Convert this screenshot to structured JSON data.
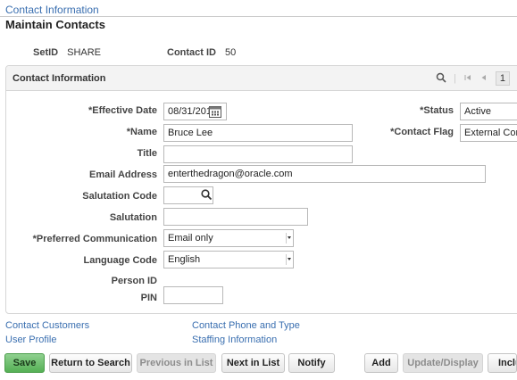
{
  "breadcrumb": "Contact Information",
  "page_title": "Maintain Contacts",
  "keys": {
    "setid_label": "SetID",
    "setid_value": "SHARE",
    "contact_id_label": "Contact ID",
    "contact_id_value": "50"
  },
  "panel": {
    "title": "Contact Information",
    "page_number": "1"
  },
  "form": {
    "effective_date_label": "*Effective Date",
    "effective_date_value": "08/31/2018",
    "status_label": "*Status",
    "status_value": "Active",
    "name_label": "*Name",
    "name_value": "Bruce Lee",
    "contact_flag_label": "*Contact Flag",
    "contact_flag_value": "External Contact",
    "title_label": "Title",
    "title_value": "",
    "email_label": "Email Address",
    "email_value": "enterthedragon@oracle.com",
    "salutation_code_label": "Salutation Code",
    "salutation_code_value": "",
    "salutation_label": "Salutation",
    "salutation_value": "",
    "preferred_comm_label": "*Preferred Communication",
    "preferred_comm_value": "Email only",
    "language_code_label": "Language Code",
    "language_code_value": "English",
    "person_id_label": "Person ID",
    "person_id_value": "",
    "pin_label": "PIN",
    "pin_value": ""
  },
  "links": {
    "contact_customers": "Contact Customers",
    "user_profile": "User Profile",
    "contact_phone": "Contact Phone and Type",
    "staffing_info": "Staffing Information"
  },
  "toolbar": {
    "save": "Save",
    "return_to_search": "Return to Search",
    "previous_in_list": "Previous in List",
    "next_in_list": "Next in List",
    "notify": "Notify",
    "add": "Add",
    "update_display": "Update/Display",
    "include_history": "Include History"
  }
}
